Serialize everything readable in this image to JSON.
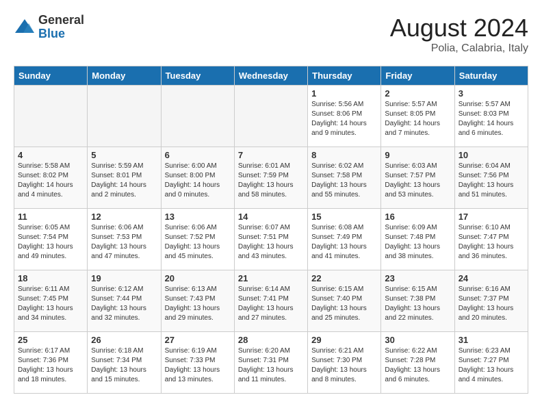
{
  "header": {
    "logo_general": "General",
    "logo_blue": "Blue",
    "month_year": "August 2024",
    "location": "Polia, Calabria, Italy"
  },
  "days_of_week": [
    "Sunday",
    "Monday",
    "Tuesday",
    "Wednesday",
    "Thursday",
    "Friday",
    "Saturday"
  ],
  "weeks": [
    [
      {
        "day": "",
        "info": ""
      },
      {
        "day": "",
        "info": ""
      },
      {
        "day": "",
        "info": ""
      },
      {
        "day": "",
        "info": ""
      },
      {
        "day": "1",
        "info": "Sunrise: 5:56 AM\nSunset: 8:06 PM\nDaylight: 14 hours\nand 9 minutes."
      },
      {
        "day": "2",
        "info": "Sunrise: 5:57 AM\nSunset: 8:05 PM\nDaylight: 14 hours\nand 7 minutes."
      },
      {
        "day": "3",
        "info": "Sunrise: 5:57 AM\nSunset: 8:03 PM\nDaylight: 14 hours\nand 6 minutes."
      }
    ],
    [
      {
        "day": "4",
        "info": "Sunrise: 5:58 AM\nSunset: 8:02 PM\nDaylight: 14 hours\nand 4 minutes."
      },
      {
        "day": "5",
        "info": "Sunrise: 5:59 AM\nSunset: 8:01 PM\nDaylight: 14 hours\nand 2 minutes."
      },
      {
        "day": "6",
        "info": "Sunrise: 6:00 AM\nSunset: 8:00 PM\nDaylight: 14 hours\nand 0 minutes."
      },
      {
        "day": "7",
        "info": "Sunrise: 6:01 AM\nSunset: 7:59 PM\nDaylight: 13 hours\nand 58 minutes."
      },
      {
        "day": "8",
        "info": "Sunrise: 6:02 AM\nSunset: 7:58 PM\nDaylight: 13 hours\nand 55 minutes."
      },
      {
        "day": "9",
        "info": "Sunrise: 6:03 AM\nSunset: 7:57 PM\nDaylight: 13 hours\nand 53 minutes."
      },
      {
        "day": "10",
        "info": "Sunrise: 6:04 AM\nSunset: 7:56 PM\nDaylight: 13 hours\nand 51 minutes."
      }
    ],
    [
      {
        "day": "11",
        "info": "Sunrise: 6:05 AM\nSunset: 7:54 PM\nDaylight: 13 hours\nand 49 minutes."
      },
      {
        "day": "12",
        "info": "Sunrise: 6:06 AM\nSunset: 7:53 PM\nDaylight: 13 hours\nand 47 minutes."
      },
      {
        "day": "13",
        "info": "Sunrise: 6:06 AM\nSunset: 7:52 PM\nDaylight: 13 hours\nand 45 minutes."
      },
      {
        "day": "14",
        "info": "Sunrise: 6:07 AM\nSunset: 7:51 PM\nDaylight: 13 hours\nand 43 minutes."
      },
      {
        "day": "15",
        "info": "Sunrise: 6:08 AM\nSunset: 7:49 PM\nDaylight: 13 hours\nand 41 minutes."
      },
      {
        "day": "16",
        "info": "Sunrise: 6:09 AM\nSunset: 7:48 PM\nDaylight: 13 hours\nand 38 minutes."
      },
      {
        "day": "17",
        "info": "Sunrise: 6:10 AM\nSunset: 7:47 PM\nDaylight: 13 hours\nand 36 minutes."
      }
    ],
    [
      {
        "day": "18",
        "info": "Sunrise: 6:11 AM\nSunset: 7:45 PM\nDaylight: 13 hours\nand 34 minutes."
      },
      {
        "day": "19",
        "info": "Sunrise: 6:12 AM\nSunset: 7:44 PM\nDaylight: 13 hours\nand 32 minutes."
      },
      {
        "day": "20",
        "info": "Sunrise: 6:13 AM\nSunset: 7:43 PM\nDaylight: 13 hours\nand 29 minutes."
      },
      {
        "day": "21",
        "info": "Sunrise: 6:14 AM\nSunset: 7:41 PM\nDaylight: 13 hours\nand 27 minutes."
      },
      {
        "day": "22",
        "info": "Sunrise: 6:15 AM\nSunset: 7:40 PM\nDaylight: 13 hours\nand 25 minutes."
      },
      {
        "day": "23",
        "info": "Sunrise: 6:15 AM\nSunset: 7:38 PM\nDaylight: 13 hours\nand 22 minutes."
      },
      {
        "day": "24",
        "info": "Sunrise: 6:16 AM\nSunset: 7:37 PM\nDaylight: 13 hours\nand 20 minutes."
      }
    ],
    [
      {
        "day": "25",
        "info": "Sunrise: 6:17 AM\nSunset: 7:36 PM\nDaylight: 13 hours\nand 18 minutes."
      },
      {
        "day": "26",
        "info": "Sunrise: 6:18 AM\nSunset: 7:34 PM\nDaylight: 13 hours\nand 15 minutes."
      },
      {
        "day": "27",
        "info": "Sunrise: 6:19 AM\nSunset: 7:33 PM\nDaylight: 13 hours\nand 13 minutes."
      },
      {
        "day": "28",
        "info": "Sunrise: 6:20 AM\nSunset: 7:31 PM\nDaylight: 13 hours\nand 11 minutes."
      },
      {
        "day": "29",
        "info": "Sunrise: 6:21 AM\nSunset: 7:30 PM\nDaylight: 13 hours\nand 8 minutes."
      },
      {
        "day": "30",
        "info": "Sunrise: 6:22 AM\nSunset: 7:28 PM\nDaylight: 13 hours\nand 6 minutes."
      },
      {
        "day": "31",
        "info": "Sunrise: 6:23 AM\nSunset: 7:27 PM\nDaylight: 13 hours\nand 4 minutes."
      }
    ]
  ]
}
